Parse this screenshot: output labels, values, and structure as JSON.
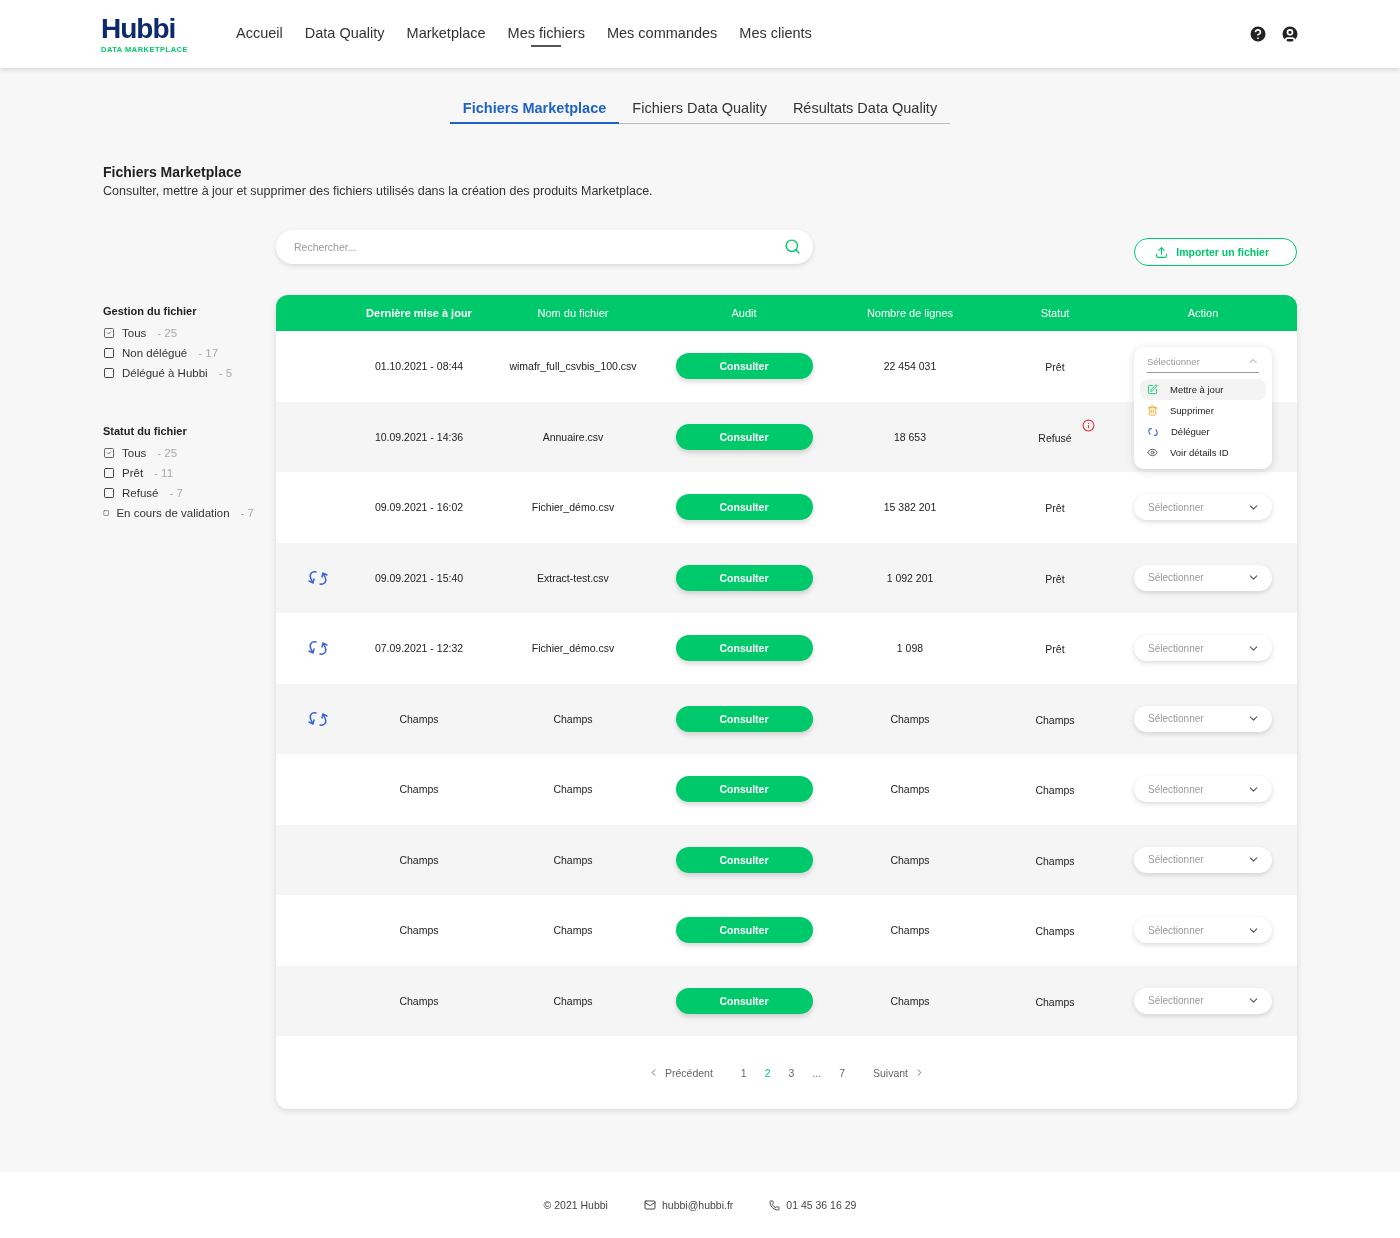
{
  "header": {
    "logo": {
      "name": "Hubbi",
      "tagline": "DATA MARKETPLACE"
    },
    "nav": [
      {
        "label": "Accueil",
        "selected": false
      },
      {
        "label": "Data Quality",
        "selected": false
      },
      {
        "label": "Marketplace",
        "selected": false
      },
      {
        "label": "Mes fichiers",
        "selected": true
      },
      {
        "label": "Mes commandes",
        "selected": false
      },
      {
        "label": "Mes clients",
        "selected": false
      }
    ]
  },
  "tabs": [
    {
      "label": "Fichiers Marketplace",
      "selected": true
    },
    {
      "label": "Fichiers Data Quality",
      "selected": false
    },
    {
      "label": "Résultats Data Quality",
      "selected": false
    }
  ],
  "page": {
    "title": "Fichiers Marketplace",
    "description": "Consulter, mettre à jour et supprimer des fichiers utilisés dans la création des produits Marketplace."
  },
  "search": {
    "placeholder": "Rechercher..."
  },
  "import_button": "Importer un fichier",
  "filters": [
    {
      "title": "Gestion du fichier",
      "options": [
        {
          "label": "Tous",
          "count": "- 25",
          "checked": true
        },
        {
          "label": "Non délégué",
          "count": "- 17",
          "checked": false
        },
        {
          "label": "Délégué à Hubbi",
          "count": "- 5",
          "checked": false
        }
      ]
    },
    {
      "title": "Statut du fichier",
      "options": [
        {
          "label": "Tous",
          "count": "- 25",
          "checked": true
        },
        {
          "label": "Prêt",
          "count": "- 11",
          "checked": false
        },
        {
          "label": "Refusé",
          "count": "- 7",
          "checked": false
        },
        {
          "label": "En cours de validation",
          "count": "- 7",
          "checked": false
        }
      ]
    }
  ],
  "table": {
    "columns": [
      "Dernière mise à jour",
      "Nom du fichier",
      "Audit",
      "Nombre de lignes",
      "Statut",
      "Action"
    ],
    "rows": [
      {
        "delegated": false,
        "date": "01.10.2021 - 08:44",
        "name": "wimafr_full_csvbis_100.csv",
        "audit": "Consulter",
        "lines": "22 454 031",
        "status": "Prêt",
        "refused": false,
        "action": {
          "placeholder": "Sélectionner",
          "open": true,
          "options": [
            {
              "kind": "edit",
              "label": "Mettre à jour",
              "selected": true
            },
            {
              "kind": "delete",
              "label": "Supprimer",
              "selected": false
            },
            {
              "kind": "delegate",
              "label": "Déléguer",
              "selected": false
            },
            {
              "kind": "view",
              "label": "Voir détails ID",
              "selected": false
            }
          ]
        }
      },
      {
        "delegated": false,
        "date": "10.09.2021 - 14:36",
        "name": "Annuaire.csv",
        "audit": "Consulter",
        "lines": "18 653",
        "status": "Refusé",
        "refused": true
      },
      {
        "delegated": false,
        "date": "09.09.2021 - 16:02",
        "name": "Fichier_démo.csv",
        "audit": "Consulter",
        "lines": "15 382 201",
        "status": "Prêt",
        "refused": false,
        "action": {
          "placeholder": "Sélectionner",
          "open": false
        }
      },
      {
        "delegated": true,
        "date": "09.09.2021 - 15:40",
        "name": "Extract-test.csv",
        "audit": "Consulter",
        "lines": "1 092 201",
        "status": "Prêt",
        "refused": false,
        "action": {
          "placeholder": "Sélectionner",
          "open": false
        }
      },
      {
        "delegated": true,
        "date": "07.09.2021 - 12:32",
        "name": "Fichier_démo.csv",
        "audit": "Consulter",
        "lines": "1 098",
        "status": "Prêt",
        "refused": false,
        "action": {
          "placeholder": "Sélectionner",
          "open": false
        }
      },
      {
        "delegated": true,
        "date": "Champs",
        "name": "Champs",
        "audit": "Consulter",
        "lines": "Champs",
        "status": "Champs",
        "refused": false,
        "action": {
          "placeholder": "Sélectionner",
          "open": false
        }
      },
      {
        "delegated": false,
        "date": "Champs",
        "name": "Champs",
        "audit": "Consulter",
        "lines": "Champs",
        "status": "Champs",
        "refused": false,
        "action": {
          "placeholder": "Sélectionner",
          "open": false
        }
      },
      {
        "delegated": false,
        "date": "Champs",
        "name": "Champs",
        "audit": "Consulter",
        "lines": "Champs",
        "status": "Champs",
        "refused": false,
        "action": {
          "placeholder": "Sélectionner",
          "open": false
        }
      },
      {
        "delegated": false,
        "date": "Champs",
        "name": "Champs",
        "audit": "Consulter",
        "lines": "Champs",
        "status": "Champs",
        "refused": false,
        "action": {
          "placeholder": "Sélectionner",
          "open": false
        }
      },
      {
        "delegated": false,
        "date": "Champs",
        "name": "Champs",
        "audit": "Consulter",
        "lines": "Champs",
        "status": "Champs",
        "refused": false,
        "action": {
          "placeholder": "Sélectionner",
          "open": false
        }
      }
    ]
  },
  "pagination": {
    "previous": "Précédent",
    "next": "Suivant",
    "pages": [
      {
        "label": "1",
        "selected": false
      },
      {
        "label": "2",
        "selected": true
      },
      {
        "label": "3",
        "selected": false
      },
      {
        "label": "...",
        "selected": false
      },
      {
        "label": "7",
        "selected": false
      }
    ]
  },
  "footer": {
    "copyright": "© 2021 Hubbi",
    "email": "hubbi@hubbi.fr",
    "phone": "01 45 36 16 29"
  }
}
